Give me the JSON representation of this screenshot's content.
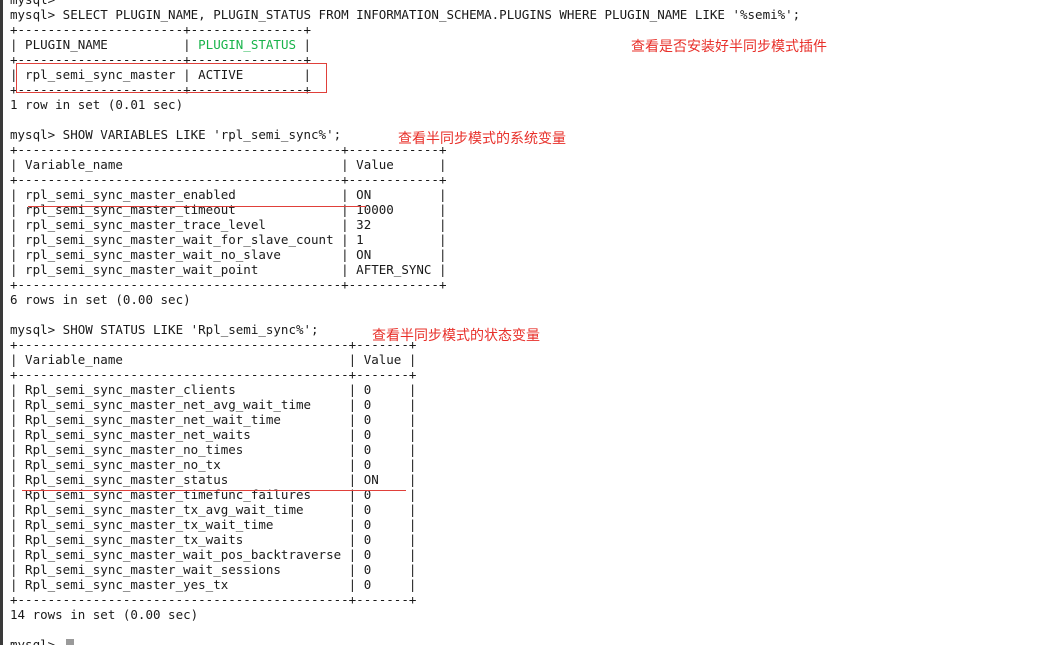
{
  "terminal": {
    "lines": [
      [
        "mysql>"
      ],
      [
        "mysql> SELECT PLUGIN_NAME, PLUGIN_STATUS FROM INFORMATION_SCHEMA.PLUGINS WHERE PLUGIN_NAME LIKE '%semi%';"
      ],
      [
        "+----------------------+---------------+"
      ],
      [
        "| PLUGIN_NAME          | ",
        "PLUGIN_STATUS",
        " |"
      ],
      [
        "+----------------------+---------------+"
      ],
      [
        "| rpl_semi_sync_master | ACTIVE        |"
      ],
      [
        "+----------------------+---------------+"
      ],
      [
        "1 row in set (0.01 sec)"
      ],
      [
        ""
      ],
      [
        "mysql> SHOW VARIABLES LIKE 'rpl_semi_sync%';"
      ],
      [
        "+-------------------------------------------+------------+"
      ],
      [
        "| Variable_name                             | Value      |"
      ],
      [
        "+-------------------------------------------+------------+"
      ],
      [
        "| rpl_semi_sync_master_enabled              | ON         |"
      ],
      [
        "| rpl_semi_sync_master_timeout              | 10000      |"
      ],
      [
        "| rpl_semi_sync_master_trace_level          | 32         |"
      ],
      [
        "| rpl_semi_sync_master_wait_for_slave_count | 1          |"
      ],
      [
        "| rpl_semi_sync_master_wait_no_slave        | ON         |"
      ],
      [
        "| rpl_semi_sync_master_wait_point           | AFTER_SYNC |"
      ],
      [
        "+-------------------------------------------+------------+"
      ],
      [
        "6 rows in set (0.00 sec)"
      ],
      [
        ""
      ],
      [
        "mysql> SHOW STATUS LIKE 'Rpl_semi_sync%';"
      ],
      [
        "+--------------------------------------------+-------+"
      ],
      [
        "| Variable_name                              | Value |"
      ],
      [
        "+--------------------------------------------+-------+"
      ],
      [
        "| Rpl_semi_sync_master_clients               | 0     |"
      ],
      [
        "| Rpl_semi_sync_master_net_avg_wait_time     | 0     |"
      ],
      [
        "| Rpl_semi_sync_master_net_wait_time         | 0     |"
      ],
      [
        "| Rpl_semi_sync_master_net_waits             | 0     |"
      ],
      [
        "| Rpl_semi_sync_master_no_times              | 0     |"
      ],
      [
        "| Rpl_semi_sync_master_no_tx                 | 0     |"
      ],
      [
        "| Rpl_semi_sync_master_status                | ON    |"
      ],
      [
        "| Rpl_semi_sync_master_timefunc_failures     | 0     |"
      ],
      [
        "| Rpl_semi_sync_master_tx_avg_wait_time      | 0     |"
      ],
      [
        "| Rpl_semi_sync_master_tx_wait_time          | 0     |"
      ],
      [
        "| Rpl_semi_sync_master_tx_waits              | 0     |"
      ],
      [
        "| Rpl_semi_sync_master_wait_pos_backtraverse | 0     |"
      ],
      [
        "| Rpl_semi_sync_master_wait_sessions         | 0     |"
      ],
      [
        "| Rpl_semi_sync_master_yes_tx                | 0     |"
      ],
      [
        "+--------------------------------------------+-------+"
      ],
      [
        "14 rows in set (0.00 sec)"
      ],
      [
        ""
      ],
      [
        "mysql> "
      ]
    ],
    "highlight_segment": [
      3,
      1
    ]
  },
  "annotations": {
    "plugin_check": "查看是否安装好半同步模式插件",
    "system_vars": "查看半同步模式的系统变量",
    "status_vars": "查看半同步模式的状态变量"
  },
  "colors": {
    "annotation": "#e8302a",
    "highlight": "#18b34a"
  }
}
